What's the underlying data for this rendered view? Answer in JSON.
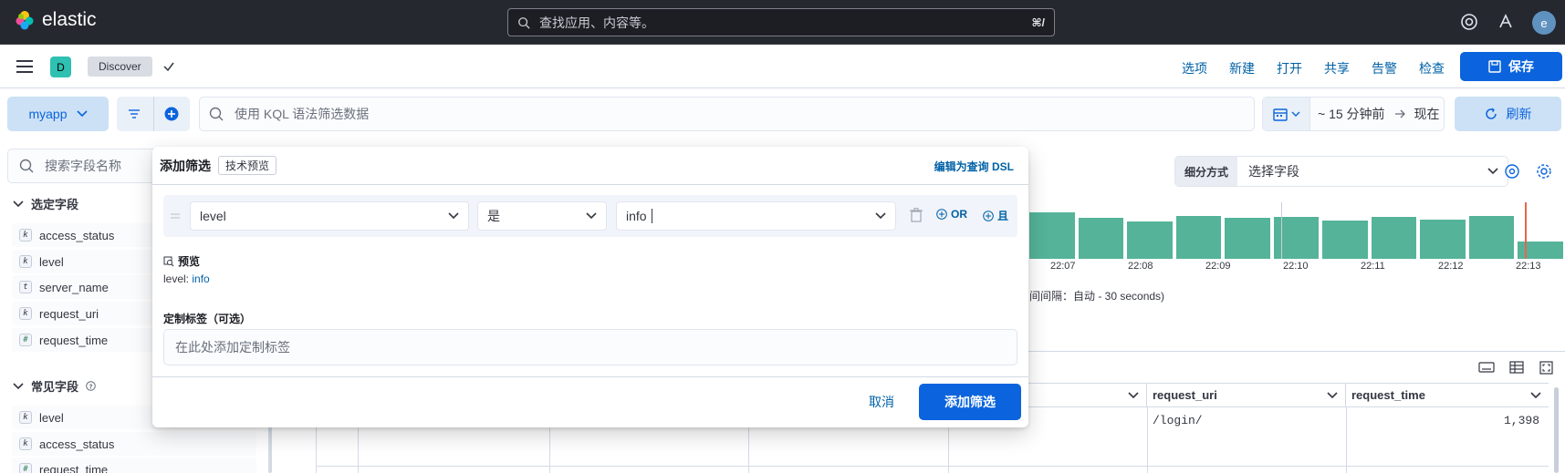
{
  "header": {
    "brand": "elastic",
    "search_placeholder": "查找应用、内容等。",
    "search_shortcut": "⌘/",
    "avatar_letter": "e"
  },
  "appbar": {
    "space_letter": "D",
    "breadcrumb": "Discover",
    "menu": [
      "选项",
      "新建",
      "打开",
      "共享",
      "告警",
      "检查"
    ],
    "save_label": "保存"
  },
  "query_bar": {
    "data_view": "myapp",
    "kql_placeholder": "使用 KQL 语法筛选数据",
    "time_range": "~ 15 分钟前",
    "time_end": "现在",
    "refresh_label": "刷新"
  },
  "sidebar": {
    "search_placeholder": "搜索字段名称",
    "selected_title": "选定字段",
    "selected_fields": [
      {
        "type": "k",
        "name": "access_status"
      },
      {
        "type": "k",
        "name": "level"
      },
      {
        "type": "t",
        "name": "server_name"
      },
      {
        "type": "k",
        "name": "request_uri"
      },
      {
        "type": "#",
        "name": "request_time"
      }
    ],
    "popular_title": "常见字段",
    "popular_fields": [
      {
        "type": "k",
        "name": "level"
      },
      {
        "type": "k",
        "name": "access_status"
      },
      {
        "type": "#",
        "name": "request_time"
      }
    ]
  },
  "histogram": {
    "breakdown_label": "细分方式",
    "breakdown_placeholder": "选择字段",
    "tick_labels": [
      "22:07",
      "22:08",
      "22:09",
      "22:10",
      "22:11",
      "22:12",
      "22:13"
    ],
    "interval_text": "间间隔：自动 - 30 seconds)",
    "bar_levels": [
      0.82,
      0.72,
      0.66,
      0.76,
      0.72,
      0.74,
      0.68,
      0.74,
      0.7,
      0.75,
      0.3
    ],
    "bar_color": "#54b399"
  },
  "grid": {
    "columns": [
      "request_uri",
      "request_time"
    ],
    "rows": [
      {
        "request_uri": "/login/",
        "request_time": "1,398"
      }
    ]
  },
  "filter_popover": {
    "title": "添加筛选",
    "badge": "技术预览",
    "edit_dsl": "编辑为查询 DSL",
    "field_value": "level",
    "operator_value": "是",
    "value_value": "info",
    "or_label": "OR",
    "and_label": "且",
    "preview_title": "预览",
    "preview_field": "level: ",
    "preview_value": "info",
    "custom_label_title": "定制标签（可选）",
    "custom_label_placeholder": "在此处添加定制标签",
    "cancel_label": "取消",
    "add_label": "添加筛选"
  }
}
